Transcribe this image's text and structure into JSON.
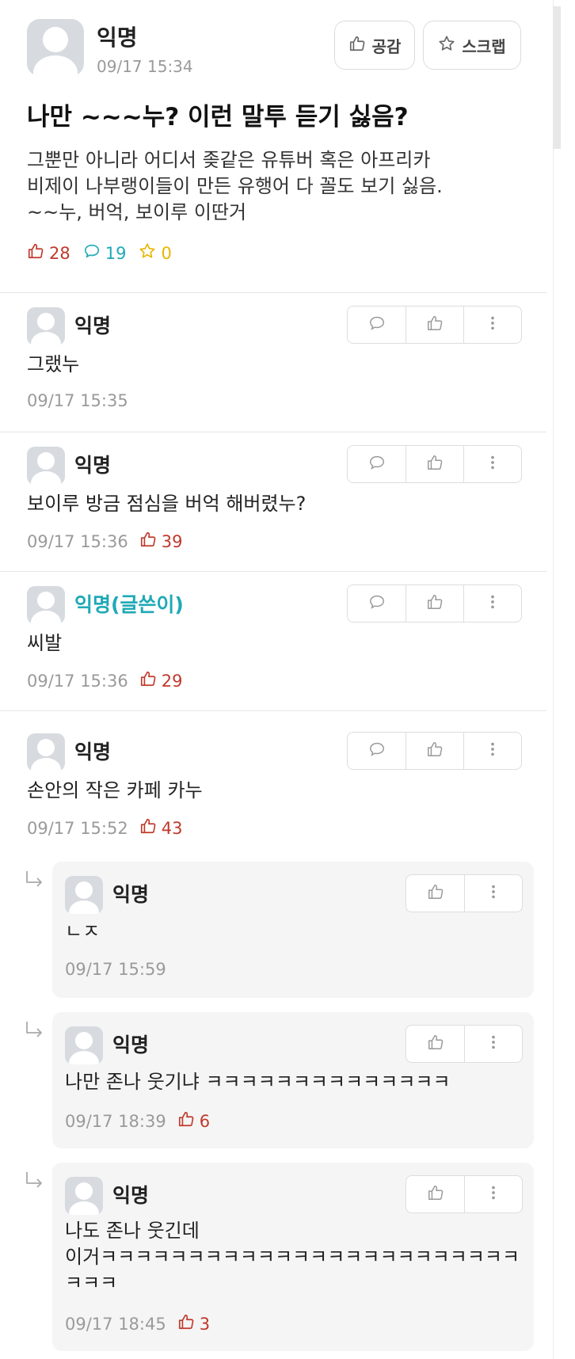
{
  "article": {
    "author": "익명",
    "date": "09/17 15:34",
    "like_button": "공감",
    "scrap_button": "스크랩",
    "title": "나만 ~~~누? 이런 말투 듣기 싫음?",
    "body_lines": [
      "그뿐만 아니라 어디서 좆같은 유튜버 혹은 아프리카",
      "비제이 나부랭이들이 만든 유행어 다 꼴도 보기 싫음.",
      "~~누, 버억, 보이루 이딴거"
    ],
    "likes": "28",
    "comments": "19",
    "scraps": "0"
  },
  "comments": [
    {
      "author": "익명",
      "text": "그랬누",
      "date": "09/17 15:35",
      "likes": ""
    },
    {
      "author": "익명",
      "text": "보이루 방금 점심을 버억 해버렸누?",
      "date": "09/17 15:36",
      "likes": "39"
    },
    {
      "author": "익명(글쓴이)",
      "text": "씨발",
      "date": "09/17 15:36",
      "likes": "29"
    },
    {
      "author": "익명",
      "text": "손안의 작은 카페 카누",
      "date": "09/17 15:52",
      "likes": "43"
    }
  ],
  "replies": [
    {
      "author": "익명",
      "lines": [
        "ㄴㅈ"
      ],
      "date": "09/17 15:59",
      "likes": ""
    },
    {
      "author": "익명",
      "lines": [
        "나만 존나 웃기냐 ㅋㅋㅋㅋㅋㅋㅋㅋㅋㅋㅋㅋㅋㅋ"
      ],
      "date": "09/17 18:39",
      "likes": "6"
    },
    {
      "author": "익명",
      "lines": [
        "나도 존나 웃긴데",
        "이거ㅋㅋㅋㅋㅋㅋㅋㅋㅋㅋㅋㅋㅋㅋㅋㅋㅋㅋㅋㅋㅋㅋㅋㅋ",
        "ㅋㅋㅋ"
      ],
      "date": "09/17 18:45",
      "likes": "3"
    }
  ],
  "colors": {
    "like": "#c0392b",
    "comment": "#1fa9b6",
    "scrap": "#e8b600",
    "op_name": "#1fa9b6"
  },
  "icons": [
    "thumbs-up-icon",
    "star-icon",
    "speech-bubble-icon",
    "more-vertical-icon",
    "reply-arrow-icon"
  ]
}
